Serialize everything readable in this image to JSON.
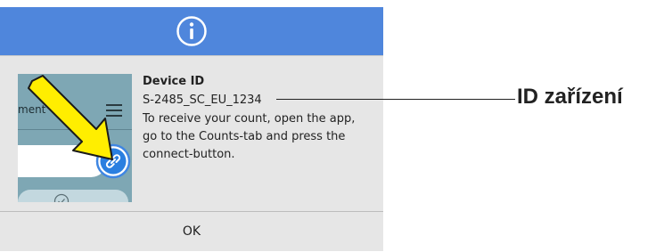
{
  "dialog": {
    "header_icon": "info-icon",
    "header_color": "#4f86dc",
    "illustration": {
      "header_label": "ment",
      "menu_icon": "hamburger-menu-icon",
      "connect_icon": "link-icon",
      "check_icon": "check-circle-icon",
      "arrow_color": "#ffee00"
    },
    "title": "Device ID",
    "device_id": "S-2485_SC_EU_1234",
    "instructions": "To receive your count, open the app, go to the Counts-tab and press the connect-button.",
    "ok_label": "OK"
  },
  "annotation": {
    "label": "ID zařízení"
  }
}
